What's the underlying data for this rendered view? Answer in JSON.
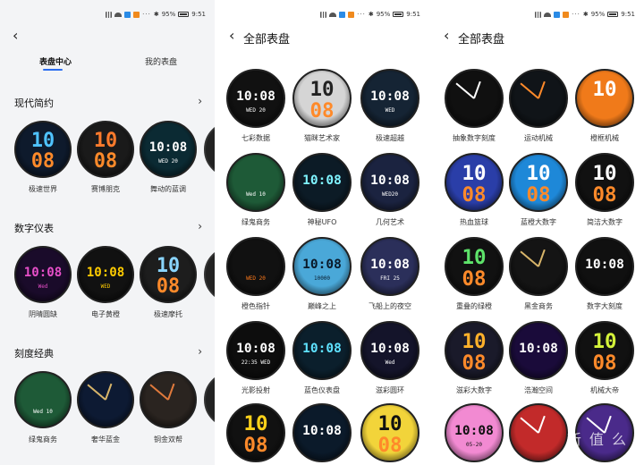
{
  "status": {
    "battery": "95%",
    "time": "9:51"
  },
  "p1": {
    "tabs": [
      "表盘中心",
      "我的表盘"
    ],
    "sections": [
      {
        "title": "现代简约",
        "faces": [
          {
            "label": "极速世界",
            "time": "10",
            "sub": "08",
            "bg": "#0e1a2c",
            "fg": "#4fc3ff"
          },
          {
            "label": "赛博朋克",
            "time": "10",
            "sub": "08",
            "bg": "#1a1a1a",
            "fg": "#ff7b2c"
          },
          {
            "label": "舞动的蓝调",
            "time": "10:08",
            "sub": "WED 20",
            "bg": "#0b2a33",
            "fg": "#ffffff"
          }
        ]
      },
      {
        "title": "数字仪表",
        "faces": [
          {
            "label": "阴晴圆缺",
            "time": "10:08",
            "sub": "Wed",
            "bg": "#1a0b2a",
            "fg": "#e64fc8"
          },
          {
            "label": "电子黄橙",
            "time": "10:08",
            "sub": "WED",
            "bg": "#111111",
            "fg": "#ffcc00"
          },
          {
            "label": "极速摩托",
            "time": "10",
            "sub": "08",
            "bg": "#1d1d1d",
            "fg": "#8ad5ff"
          }
        ]
      },
      {
        "title": "刻度经典",
        "faces": [
          {
            "label": "绿鬼商务",
            "time": "",
            "sub": "Wed 10",
            "bg": "#1e5a37",
            "fg": "#ffffff"
          },
          {
            "label": "奢华蓝金",
            "time": "",
            "sub": "",
            "bg": "#0d1a33",
            "fg": "#d8b56a"
          },
          {
            "label": "铜金双帮",
            "time": "",
            "sub": "",
            "bg": "#2a2420",
            "fg": "#e07a3c"
          }
        ]
      }
    ]
  },
  "p2": {
    "title": "全部表盘",
    "faces": [
      {
        "label": "七彩数据",
        "time": "10:08",
        "sub": "WED 20",
        "bg": "#111111",
        "fg": "#ffffff"
      },
      {
        "label": "猫眯艺术家",
        "time": "10",
        "sub": "08",
        "bg": "#d5d5d5",
        "fg": "#222222"
      },
      {
        "label": "极速超越",
        "time": "10:08",
        "sub": "WED",
        "bg": "#152434",
        "fg": "#ffffff"
      },
      {
        "label": "绿鬼商务",
        "time": "",
        "sub": "Wed 10",
        "bg": "#1e5a37",
        "fg": "#ffffff"
      },
      {
        "label": "神秘UFO",
        "time": "10:08",
        "sub": "",
        "bg": "#0c1b26",
        "fg": "#7ff3ff"
      },
      {
        "label": "几何艺术",
        "time": "10:08",
        "sub": "WED20",
        "bg": "#1b2340",
        "fg": "#ffffff"
      },
      {
        "label": "橙色指针",
        "time": "",
        "sub": "WED 20",
        "bg": "#111111",
        "fg": "#ff7a1a"
      },
      {
        "label": "巅峰之上",
        "time": "10:08",
        "sub": "10000",
        "bg": "#4aa8d8",
        "fg": "#0a1a2a"
      },
      {
        "label": "飞船上的夜空",
        "time": "10:08",
        "sub": "FRI 25",
        "bg": "#2b2f5a",
        "fg": "#ffffff"
      },
      {
        "label": "光影投射",
        "time": "10:08",
        "sub": "22:35 WED",
        "bg": "#0d0d0d",
        "fg": "#ffffff"
      },
      {
        "label": "蓝色仪表盘",
        "time": "10:08",
        "sub": "",
        "bg": "#0b1f2c",
        "fg": "#5fe2ff"
      },
      {
        "label": "滋彩圆环",
        "time": "10:08",
        "sub": "Wed",
        "bg": "#14142a",
        "fg": "#ffffff"
      },
      {
        "label": "",
        "time": "10",
        "sub": "08",
        "bg": "#111111",
        "fg": "#ffd21a"
      },
      {
        "label": "",
        "time": "10:08",
        "sub": "",
        "bg": "#0b1a2a",
        "fg": "#ffffff"
      },
      {
        "label": "",
        "time": "10",
        "sub": "08",
        "bg": "#f2d43a",
        "fg": "#111111"
      }
    ]
  },
  "p3": {
    "title": "全部表盘",
    "faces": [
      {
        "label": "抽象数字刻度",
        "time": "",
        "sub": "",
        "bg": "#101010",
        "fg": "#ffffff"
      },
      {
        "label": "运动机械",
        "time": "",
        "sub": "",
        "bg": "#101418",
        "fg": "#ff8a2a"
      },
      {
        "label": "橙框机械",
        "time": "10",
        "sub": "",
        "bg": "#f07a1a",
        "fg": "#ffffff"
      },
      {
        "label": "热血篮球",
        "time": "10",
        "sub": "08",
        "bg": "#2a3ea8",
        "fg": "#ffffff"
      },
      {
        "label": "蓝橙大数字",
        "time": "10",
        "sub": "08",
        "bg": "#1e88d8",
        "fg": "#ffffff"
      },
      {
        "label": "简洁大数字",
        "time": "10",
        "sub": "08",
        "bg": "#111111",
        "fg": "#ffffff"
      },
      {
        "label": "重叠的绿橙",
        "time": "10",
        "sub": "08",
        "bg": "#111111",
        "fg": "#5ee36a"
      },
      {
        "label": "黑金商务",
        "time": "",
        "sub": "",
        "bg": "#141414",
        "fg": "#d8b56a"
      },
      {
        "label": "数字大刻度",
        "time": "10:08",
        "sub": "",
        "bg": "#101010",
        "fg": "#ffffff"
      },
      {
        "label": "滋彩大数字",
        "time": "10",
        "sub": "08",
        "bg": "#1a1a2a",
        "fg": "#ffb12a"
      },
      {
        "label": "浩瀚空间",
        "time": "10:08",
        "sub": "",
        "bg": "#1a0b3a",
        "fg": "#ffffff"
      },
      {
        "label": "机械大帝",
        "time": "10",
        "sub": "08",
        "bg": "#111111",
        "fg": "#d4f23a"
      },
      {
        "label": "",
        "time": "10:08",
        "sub": "05-20",
        "bg": "#f28ad2",
        "fg": "#111111"
      },
      {
        "label": "",
        "time": "",
        "sub": "",
        "bg": "#c22a2a",
        "fg": "#ffffff"
      },
      {
        "label": "",
        "time": "",
        "sub": "",
        "bg": "#4a2a8a",
        "fg": "#ffffff"
      }
    ],
    "watermark": "新 值 么"
  }
}
